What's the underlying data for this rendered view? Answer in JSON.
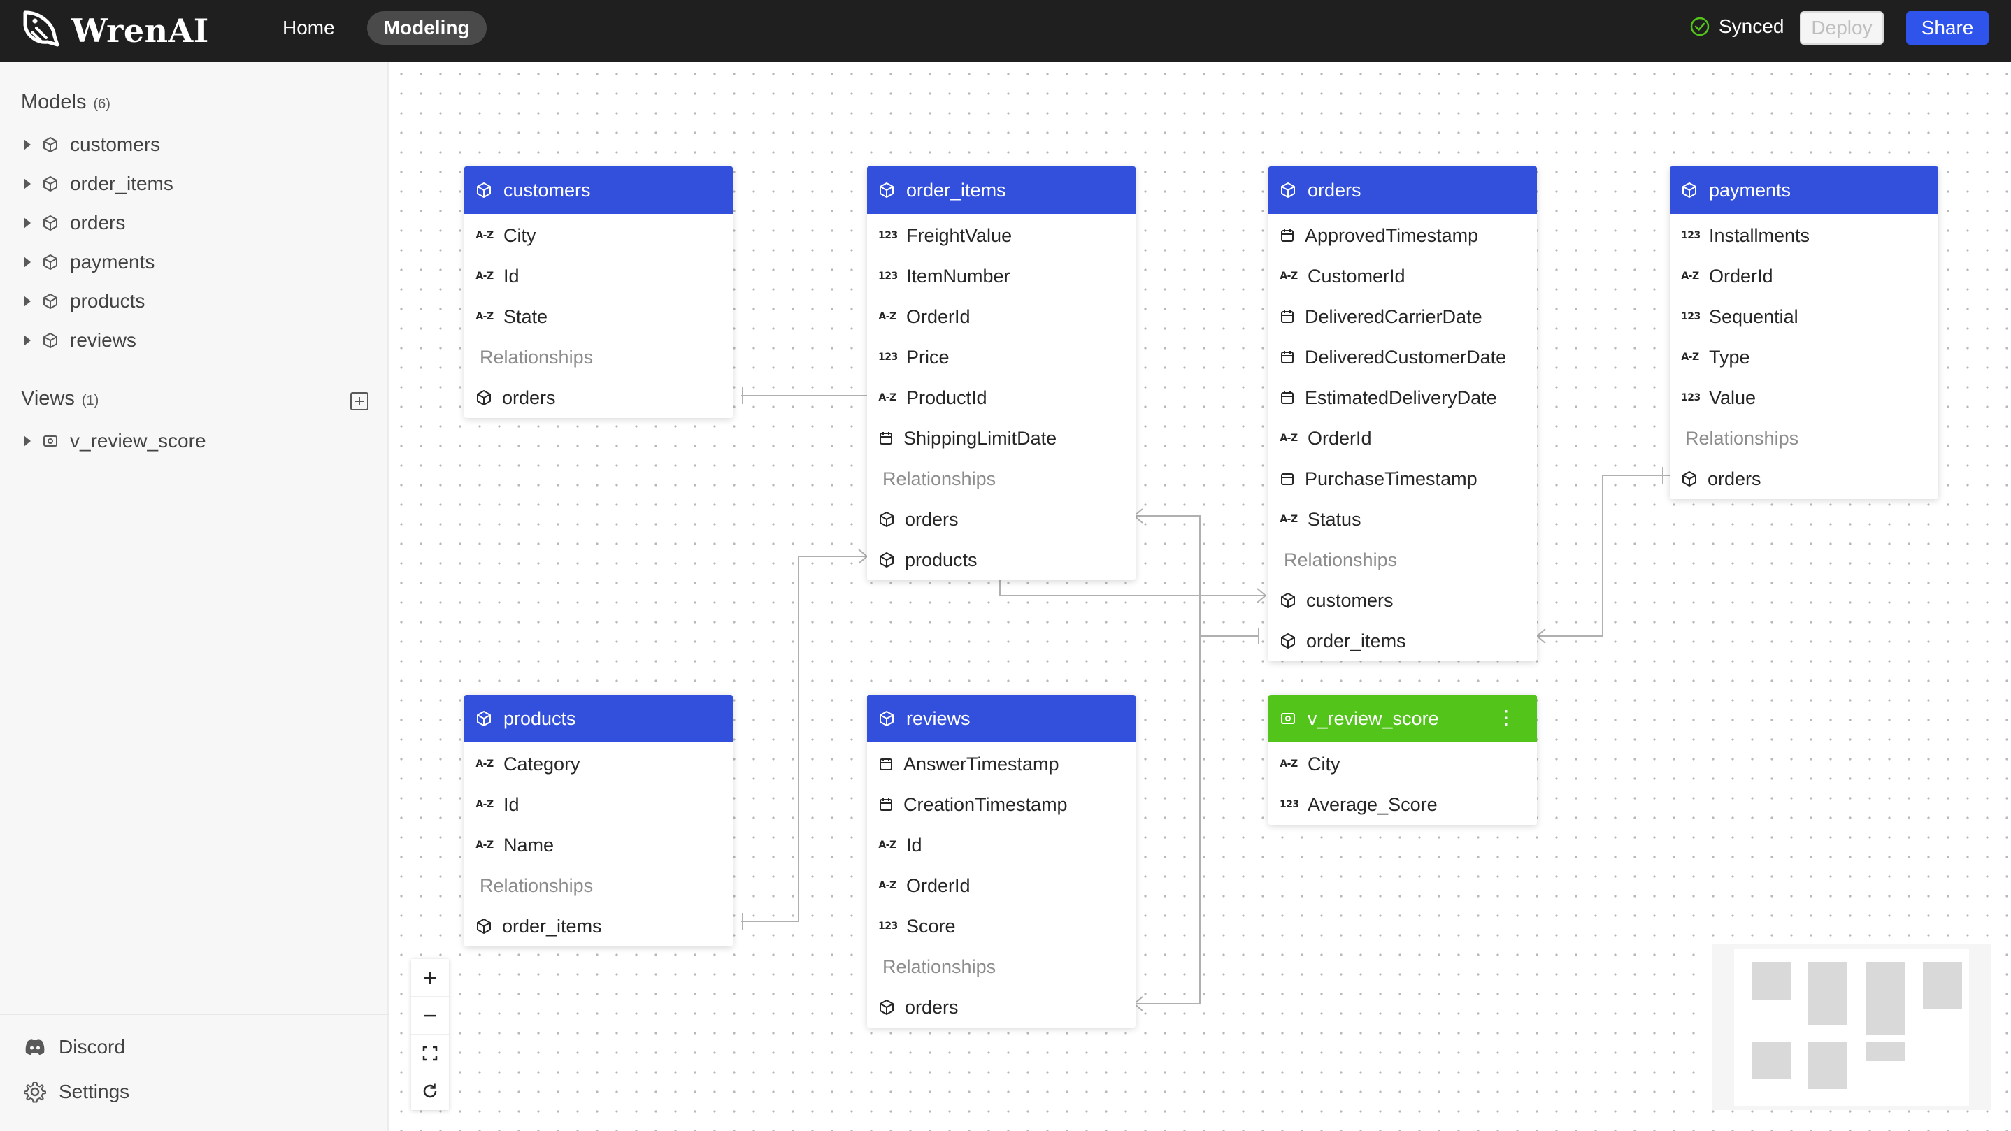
{
  "app": {
    "name": "WrenAI",
    "nav": [
      {
        "label": "Home",
        "active": false
      },
      {
        "label": "Modeling",
        "active": true
      }
    ],
    "status": "Synced",
    "deploy_label": "Deploy",
    "share_label": "Share",
    "colors": {
      "header": "#1f1f1f",
      "primary": "#2f54eb",
      "model_head": "#3350dd",
      "view_head": "#52c41a",
      "synced": "#52c41a"
    }
  },
  "sidebar": {
    "models_title": "Models",
    "models_count": "(6)",
    "models": [
      "customers",
      "order_items",
      "orders",
      "payments",
      "products",
      "reviews"
    ],
    "views_title": "Views",
    "views_count": "(1)",
    "views": [
      "v_review_score"
    ],
    "discord_label": "Discord",
    "settings_label": "Settings"
  },
  "relationships_label": "Relationships",
  "nodes": {
    "customers": {
      "title": "customers",
      "fields": [
        {
          "type": "A-Z",
          "name": "City"
        },
        {
          "type": "A-Z",
          "name": "Id"
        },
        {
          "type": "A-Z",
          "name": "State"
        }
      ],
      "relationships": [
        "orders"
      ]
    },
    "order_items": {
      "title": "order_items",
      "fields": [
        {
          "type": "123",
          "name": "FreightValue"
        },
        {
          "type": "123",
          "name": "ItemNumber"
        },
        {
          "type": "A-Z",
          "name": "OrderId"
        },
        {
          "type": "123",
          "name": "Price"
        },
        {
          "type": "A-Z",
          "name": "ProductId"
        },
        {
          "type": "date",
          "name": "ShippingLimitDate"
        }
      ],
      "relationships": [
        "orders",
        "products"
      ]
    },
    "orders": {
      "title": "orders",
      "fields": [
        {
          "type": "date",
          "name": "ApprovedTimestamp"
        },
        {
          "type": "A-Z",
          "name": "CustomerId"
        },
        {
          "type": "date",
          "name": "DeliveredCarrierDate"
        },
        {
          "type": "date",
          "name": "DeliveredCustomerDate"
        },
        {
          "type": "date",
          "name": "EstimatedDeliveryDate"
        },
        {
          "type": "A-Z",
          "name": "OrderId"
        },
        {
          "type": "date",
          "name": "PurchaseTimestamp"
        },
        {
          "type": "A-Z",
          "name": "Status"
        }
      ],
      "relationships": [
        "customers",
        "order_items"
      ]
    },
    "payments": {
      "title": "payments",
      "fields": [
        {
          "type": "123",
          "name": "Installments"
        },
        {
          "type": "A-Z",
          "name": "OrderId"
        },
        {
          "type": "123",
          "name": "Sequential"
        },
        {
          "type": "A-Z",
          "name": "Type"
        },
        {
          "type": "123",
          "name": "Value"
        }
      ],
      "relationships": [
        "orders"
      ]
    },
    "products": {
      "title": "products",
      "fields": [
        {
          "type": "A-Z",
          "name": "Category"
        },
        {
          "type": "A-Z",
          "name": "Id"
        },
        {
          "type": "A-Z",
          "name": "Name"
        }
      ],
      "relationships": [
        "order_items"
      ]
    },
    "reviews": {
      "title": "reviews",
      "fields": [
        {
          "type": "date",
          "name": "AnswerTimestamp"
        },
        {
          "type": "date",
          "name": "CreationTimestamp"
        },
        {
          "type": "A-Z",
          "name": "Id"
        },
        {
          "type": "A-Z",
          "name": "OrderId"
        },
        {
          "type": "123",
          "name": "Score"
        }
      ],
      "relationships": [
        "orders"
      ]
    },
    "v_review_score": {
      "title": "v_review_score",
      "fields": [
        {
          "type": "A-Z",
          "name": "City"
        },
        {
          "type": "123",
          "name": "Average_Score"
        }
      ],
      "relationships": []
    }
  },
  "zoom_controls": [
    "zoom-in-icon",
    "zoom-out-icon",
    "fit-view-icon",
    "reset-icon"
  ]
}
